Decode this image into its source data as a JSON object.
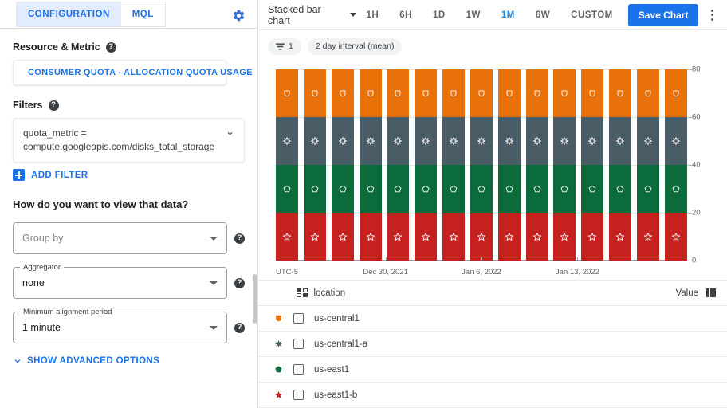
{
  "left_panel": {
    "tabs": [
      {
        "label": "CONFIGURATION",
        "active": true
      },
      {
        "label": "MQL",
        "active": false
      }
    ],
    "settings_icon": "gear-icon",
    "resource_metric": {
      "label": "Resource & Metric",
      "help": "?",
      "selected": "CONSUMER QUOTA - ALLOCATION QUOTA USAGE",
      "icon": "bar-chart-icon"
    },
    "filters": {
      "label": "Filters",
      "help": "?",
      "items": [
        {
          "text": "quota_metric = compute.googleapis.com/disks_total_storage"
        }
      ],
      "add_filter_label": "ADD FILTER",
      "add_filter_icon": "plus-square-icon"
    },
    "view_section": {
      "heading": "How do you want to view that data?",
      "fields": [
        {
          "legend": "",
          "placeholder": "Group by",
          "value": "",
          "help": "?"
        },
        {
          "legend": "Aggregator",
          "placeholder": "",
          "value": "none",
          "help": "?"
        },
        {
          "legend": "Minimum alignment period",
          "placeholder": "",
          "value": "1 minute",
          "help": "?"
        }
      ],
      "show_advanced_label": "SHOW ADVANCED OPTIONS",
      "show_advanced_icon": "chevron-down-icon"
    }
  },
  "right_panel": {
    "toolbar": {
      "chart_type": "Stacked bar chart",
      "chart_type_icon": "chevron-down-icon",
      "ranges": [
        {
          "label": "1H",
          "active": false
        },
        {
          "label": "6H",
          "active": false
        },
        {
          "label": "1D",
          "active": false
        },
        {
          "label": "1W",
          "active": false
        },
        {
          "label": "1M",
          "active": true
        },
        {
          "label": "6W",
          "active": false
        },
        {
          "label": "CUSTOM",
          "active": false
        }
      ],
      "save_chart_label": "Save Chart",
      "menu_icon": "kebab-menu-icon"
    },
    "chips": [
      {
        "label": "1",
        "icon": "filter-icon"
      },
      {
        "label": "2 day interval (mean)",
        "icon": ""
      }
    ],
    "legend_table": {
      "group_column_label": "location",
      "group_column_icon": "grid-icon",
      "value_column_label": "Value",
      "value_column_icon": "columns-icon",
      "rows": [
        {
          "label": "us-central1",
          "color": "#E8710A",
          "marker": "shield"
        },
        {
          "label": "us-central1-a",
          "color": "#4A5C66",
          "marker": "asterisk"
        },
        {
          "label": "us-east1",
          "color": "#0B6B3A",
          "marker": "pentagon"
        },
        {
          "label": "us-east1-b",
          "color": "#C5221F",
          "marker": "star"
        }
      ]
    }
  },
  "chart_data": {
    "type": "bar",
    "title": "",
    "subtitle": "",
    "stacked": true,
    "xlabel": "",
    "ylabel": "",
    "timezone_label": "UTC-5",
    "ylim": [
      0,
      80
    ],
    "yticks": [
      0,
      20,
      40,
      60,
      80
    ],
    "grid": true,
    "legend_position": "bottom-table",
    "x_tick_labels": [
      "Dec 30, 2021",
      "Jan 6, 2022",
      "Jan 13, 2022"
    ],
    "x_tick_positions": [
      4,
      7.5,
      11
    ],
    "categories": [
      "b1",
      "b2",
      "b3",
      "b4",
      "b5",
      "b6",
      "b7",
      "b8",
      "b9",
      "b10",
      "b11",
      "b12",
      "b13",
      "b14",
      "b15"
    ],
    "series": [
      {
        "name": "us-east1-b",
        "color": "#C5221F",
        "marker": "star",
        "values": [
          20,
          20,
          20,
          20,
          20,
          20,
          20,
          20,
          20,
          20,
          20,
          20,
          20,
          20,
          20
        ]
      },
      {
        "name": "us-east1",
        "color": "#0B6B3A",
        "marker": "pentagon",
        "values": [
          20,
          20,
          20,
          20,
          20,
          20,
          20,
          20,
          20,
          20,
          20,
          20,
          20,
          20,
          20
        ]
      },
      {
        "name": "us-central1-a",
        "color": "#4A5C66",
        "marker": "asterisk",
        "values": [
          20,
          20,
          20,
          20,
          20,
          20,
          20,
          20,
          20,
          20,
          20,
          20,
          20,
          20,
          20
        ]
      },
      {
        "name": "us-central1",
        "color": "#E8710A",
        "marker": "shield",
        "values": [
          20,
          20,
          20,
          20,
          20,
          20,
          20,
          20,
          20,
          20,
          20,
          20,
          20,
          20,
          20
        ]
      }
    ]
  }
}
